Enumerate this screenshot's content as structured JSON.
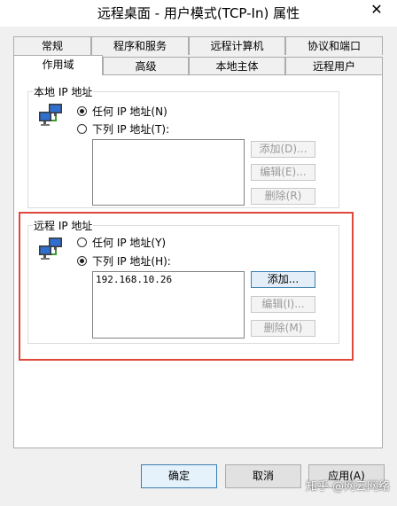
{
  "window": {
    "title": "远程桌面 - 用户模式(TCP-In) 属性",
    "close_glyph": "✕"
  },
  "tabs_row1": [
    {
      "label": "常规"
    },
    {
      "label": "程序和服务"
    },
    {
      "label": "远程计算机"
    },
    {
      "label": "协议和端口"
    }
  ],
  "tabs_row2": [
    {
      "label": "作用域",
      "active": true
    },
    {
      "label": "高级"
    },
    {
      "label": "本地主体"
    },
    {
      "label": "远程用户"
    }
  ],
  "local_ip": {
    "title": "本地 IP 地址",
    "icon": "network-computers-icon",
    "any_label": "任何 IP 地址(N)",
    "list_label": "下列 IP 地址(T):",
    "selected": "any",
    "addresses": [],
    "add_label": "添加(D)...",
    "edit_label": "编辑(E)...",
    "delete_label": "删除(R)"
  },
  "remote_ip": {
    "title": "远程 IP 地址",
    "icon": "network-computers-icon",
    "any_label": "任何 IP 地址(Y)",
    "list_label": "下列 IP 地址(H):",
    "selected": "list",
    "addresses": [
      "192.168.10.26"
    ],
    "add_label": "添加...",
    "edit_label": "编辑(I)...",
    "delete_label": "删除(M)"
  },
  "footer": {
    "ok_label": "确定",
    "cancel_label": "取消",
    "apply_label": "应用(A)"
  },
  "watermark": "知乎 @网云网络",
  "colors": {
    "highlight": "#e0483d",
    "dialog_bg": "#f0f0f0"
  }
}
